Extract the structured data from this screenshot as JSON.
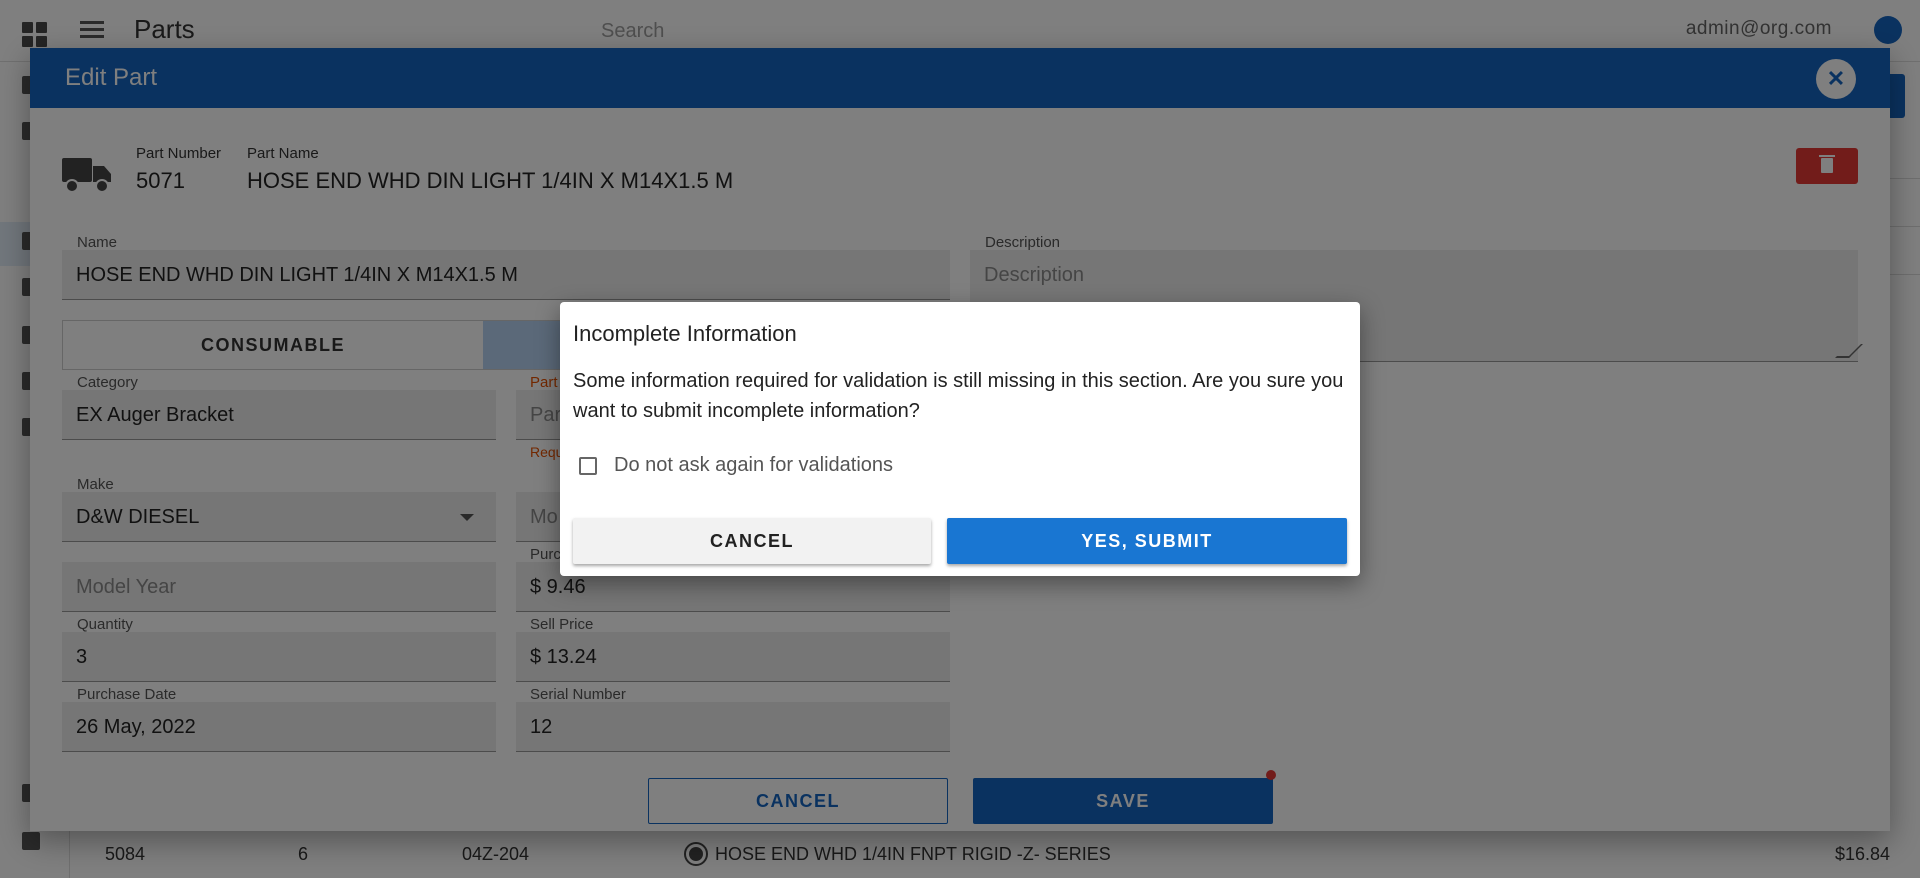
{
  "app": {
    "title": "Parts",
    "search_placeholder": "Search",
    "user_email": "admin@org.com"
  },
  "background_row": {
    "part_number": "5084",
    "quantity": "6",
    "code": "04Z-204",
    "name": "HOSE END WHD 1/4IN FNPT RIGID -Z- SERIES",
    "price": "$16.84"
  },
  "edit_dialog": {
    "title": "Edit Part",
    "part_number_label": "Part Number",
    "part_number": "5071",
    "part_name_label": "Part Name",
    "part_name": "HOSE END WHD DIN LIGHT 1/4IN X M14X1.5 M",
    "name_label": "Name",
    "name_value": "HOSE END WHD DIN LIGHT 1/4IN X M14X1.5 M",
    "description_label": "Description",
    "description_placeholder": "Description",
    "type_options": [
      "CONSUMABLE",
      ""
    ],
    "category_label": "Category",
    "category_value": "EX Auger Bracket",
    "part_label_partial": "Part",
    "part_placeholder_partial": "Par",
    "required_partial": "Requ",
    "make_label": "Make",
    "make_value": "D&W DIESEL",
    "model_placeholder_partial": "Mo",
    "model_year_placeholder": "Model Year",
    "purchase_label_partial": "Purc",
    "purchase_price": "$ 9.46",
    "quantity_label": "Quantity",
    "quantity_value": "3",
    "sell_price_label": "Sell Price",
    "sell_price": "$ 13.24",
    "purchase_date_label": "Purchase Date",
    "purchase_date": "26 May, 2022",
    "serial_number_label": "Serial Number",
    "serial_number": "12",
    "cancel_label": "CANCEL",
    "save_label": "SAVE"
  },
  "confirm_dialog": {
    "title": "Incomplete Information",
    "message": "Some information required for validation is still missing in this section. Are you sure you want to submit incomplete information?",
    "checkbox_label": "Do not ask again for validations",
    "cancel_label": "CANCEL",
    "submit_label": "YES, SUBMIT"
  },
  "colors": {
    "primary": "#1565c0",
    "danger": "#e53935",
    "warning": "#e65100"
  }
}
